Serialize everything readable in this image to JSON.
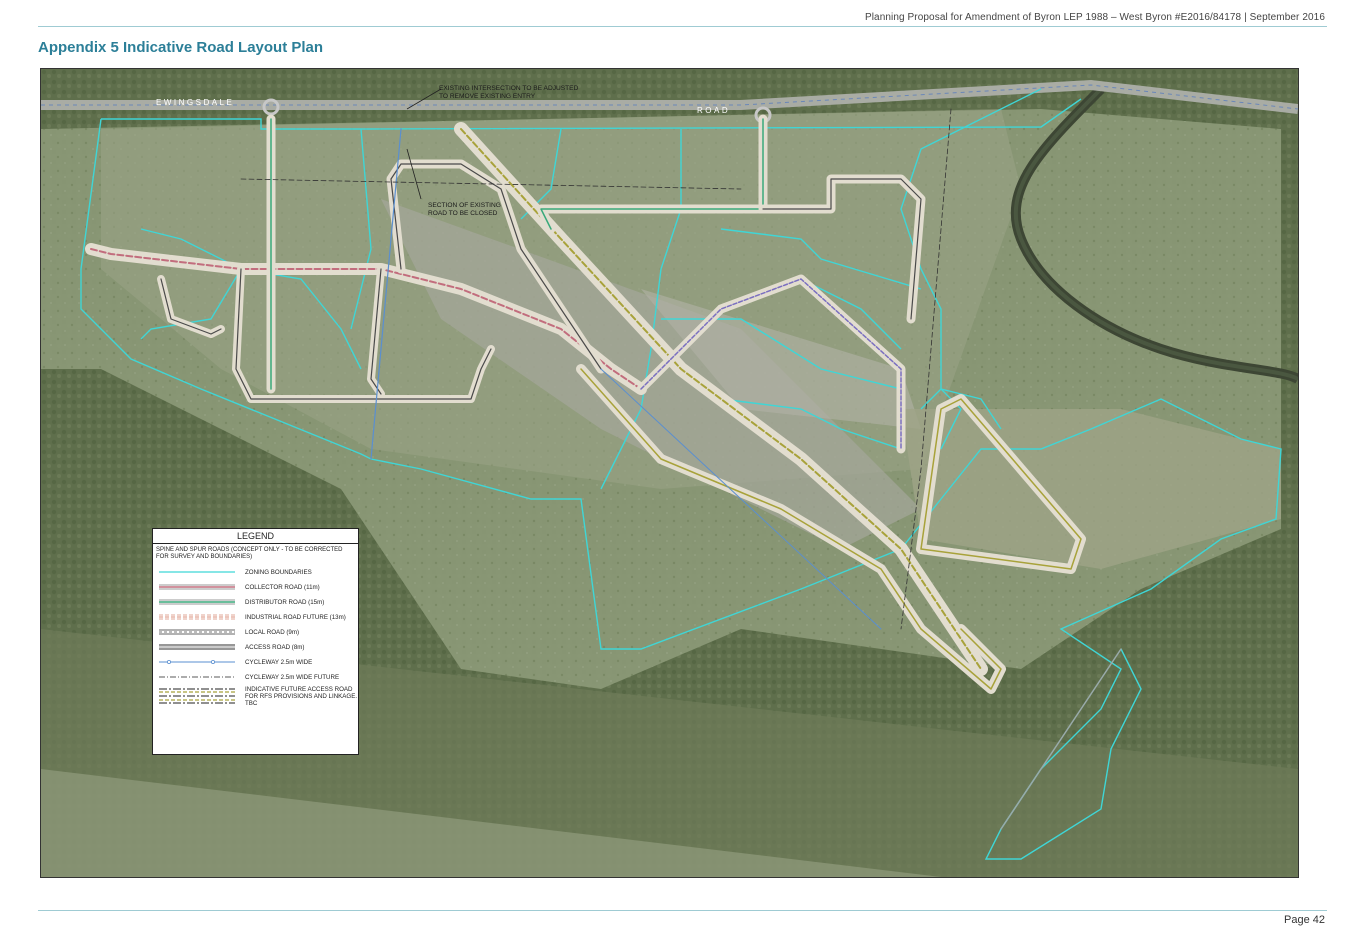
{
  "header": {
    "document_ref": "Planning Proposal for Amendment of Byron LEP 1988 – West Byron #E2016/84178 | September 2016"
  },
  "title": "Appendix 5 Indicative Road Layout Plan",
  "map": {
    "road_labels": {
      "ewingsdale": "EWINGSDALE",
      "road": "ROAD"
    },
    "annotations": {
      "intersection_line1": "EXISTING INTERSECTION TO BE ADJUSTED",
      "intersection_line2": "TO REMOVE EXISTING ENTRY",
      "closure_line1": "SECTION OF EXISTING",
      "closure_line2": "ROAD TO BE CLOSED"
    },
    "colors": {
      "zoning_boundary": "#3fd6d6",
      "collector_road": "#c26d7d",
      "distributor_road": "#39a97a",
      "industrial_road": "#d88c7a",
      "local_road": "#4a4a4a",
      "access_road": "#2f2f2f",
      "cycleway": "#5a8fd0",
      "future_access": "#a8a23a",
      "aerial_base": "#7f8a6d"
    }
  },
  "legend": {
    "title": "LEGEND",
    "note": "SPINE AND SPUR ROADS (CONCEPT ONLY - TO BE CORRECTED FOR SURVEY AND BOUNDARIES)",
    "items": [
      {
        "label": "ZONING BOUNDARIES",
        "symbol": "zoning"
      },
      {
        "label": "COLLECTOR ROAD (11m)",
        "symbol": "collector"
      },
      {
        "label": "DISTRIBUTOR ROAD (15m)",
        "symbol": "distributor"
      },
      {
        "label": "INDUSTRIAL ROAD FUTURE (13m)",
        "symbol": "industrial"
      },
      {
        "label": "LOCAL ROAD (9m)",
        "symbol": "local"
      },
      {
        "label": "ACCESS ROAD (8m)",
        "symbol": "access"
      },
      {
        "label": "CYCLEWAY 2.5m WIDE",
        "symbol": "cycleway"
      },
      {
        "label": "CYCLEWAY 2.5m WIDE FUTURE",
        "symbol": "cycleway-future"
      },
      {
        "label": "INDICATIVE FUTURE ACCESS ROAD FOR RFS PROVISIONS AND LINKAGE. TBC",
        "symbol": "future-access"
      }
    ]
  },
  "footer": {
    "page_number": "Page 42"
  }
}
